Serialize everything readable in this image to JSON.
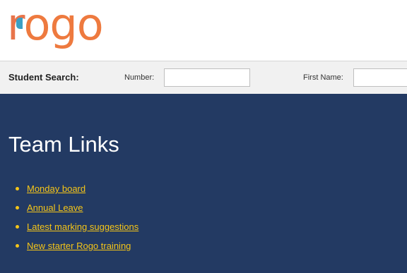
{
  "header": {
    "logo_r": "r",
    "logo_rest": "ogo"
  },
  "search": {
    "title": "Student Search:",
    "number_label": "Number:",
    "number_value": "",
    "first_name_label": "First Name:",
    "first_name_value": ""
  },
  "main": {
    "title": "Team Links",
    "links": [
      {
        "label": "Monday board"
      },
      {
        "label": "Annual Leave "
      },
      {
        "label": "Latest marking suggestions"
      },
      {
        "label": "New starter Rogo training"
      }
    ]
  },
  "colors": {
    "logo_orange": "#ee7a3f",
    "logo_blue": "#3a9fc4",
    "main_background": "#233a63",
    "link_yellow": "#f5c518"
  }
}
